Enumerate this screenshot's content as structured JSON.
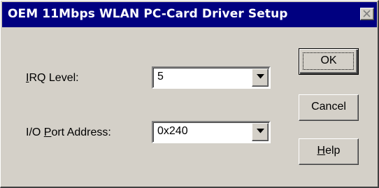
{
  "window": {
    "title": "OEM 11Mbps WLAN PC-Card Driver Setup"
  },
  "irq": {
    "label_accel": "I",
    "label_rest": "RQ Level:",
    "value": "5"
  },
  "io_port": {
    "label_pre": "I/O ",
    "label_accel": "P",
    "label_rest": "ort Address:",
    "value": "0x240"
  },
  "buttons": {
    "ok": "OK",
    "cancel": "Cancel",
    "help_accel": "H",
    "help_rest": "elp"
  },
  "colors": {
    "titlebar": "#000080",
    "face": "#d4d0c8"
  }
}
